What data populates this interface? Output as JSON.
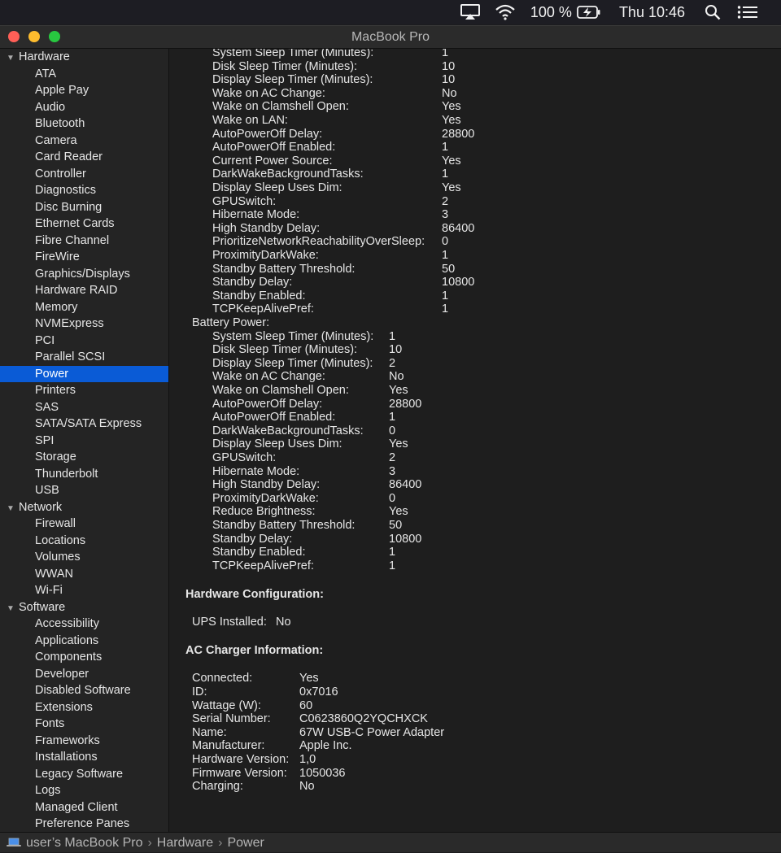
{
  "menubar": {
    "battery_percent": "100 %",
    "clock": "Thu 10:46"
  },
  "window": {
    "title": "MacBook Pro"
  },
  "sidebar": {
    "groups": [
      {
        "label": "Hardware",
        "items": [
          "ATA",
          "Apple Pay",
          "Audio",
          "Bluetooth",
          "Camera",
          "Card Reader",
          "Controller",
          "Diagnostics",
          "Disc Burning",
          "Ethernet Cards",
          "Fibre Channel",
          "FireWire",
          "Graphics/Displays",
          "Hardware RAID",
          "Memory",
          "NVMExpress",
          "PCI",
          "Parallel SCSI",
          "Power",
          "Printers",
          "SAS",
          "SATA/SATA Express",
          "SPI",
          "Storage",
          "Thunderbolt",
          "USB"
        ]
      },
      {
        "label": "Network",
        "items": [
          "Firewall",
          "Locations",
          "Volumes",
          "WWAN",
          "Wi-Fi"
        ]
      },
      {
        "label": "Software",
        "items": [
          "Accessibility",
          "Applications",
          "Components",
          "Developer",
          "Disabled Software",
          "Extensions",
          "Fonts",
          "Frameworks",
          "Installations",
          "Legacy Software",
          "Logs",
          "Managed Client",
          "Preference Panes"
        ]
      }
    ],
    "selected": "Power"
  },
  "content": {
    "ac_power_settings": [
      [
        "System Sleep Timer (Minutes):",
        "1"
      ],
      [
        "Disk Sleep Timer (Minutes):",
        "10"
      ],
      [
        "Display Sleep Timer (Minutes):",
        "10"
      ],
      [
        "Wake on AC Change:",
        "No"
      ],
      [
        "Wake on Clamshell Open:",
        "Yes"
      ],
      [
        "Wake on LAN:",
        "Yes"
      ],
      [
        "AutoPowerOff Delay:",
        "28800"
      ],
      [
        "AutoPowerOff Enabled:",
        "1"
      ],
      [
        "Current Power Source:",
        "Yes"
      ],
      [
        "DarkWakeBackgroundTasks:",
        "1"
      ],
      [
        "Display Sleep Uses Dim:",
        "Yes"
      ],
      [
        "GPUSwitch:",
        "2"
      ],
      [
        "Hibernate Mode:",
        "3"
      ],
      [
        "High Standby Delay:",
        "86400"
      ],
      [
        "PrioritizeNetworkReachabilityOverSleep:",
        "0"
      ],
      [
        "ProximityDarkWake:",
        "1"
      ],
      [
        "Standby Battery Threshold:",
        "50"
      ],
      [
        "Standby Delay:",
        "10800"
      ],
      [
        "Standby Enabled:",
        "1"
      ],
      [
        "TCPKeepAlivePref:",
        "1"
      ]
    ],
    "battery_power_label": "Battery Power:",
    "battery_power_settings": [
      [
        "System Sleep Timer (Minutes):",
        "1"
      ],
      [
        "Disk Sleep Timer (Minutes):",
        "10"
      ],
      [
        "Display Sleep Timer (Minutes):",
        "2"
      ],
      [
        "Wake on AC Change:",
        "No"
      ],
      [
        "Wake on Clamshell Open:",
        "Yes"
      ],
      [
        "AutoPowerOff Delay:",
        "28800"
      ],
      [
        "AutoPowerOff Enabled:",
        "1"
      ],
      [
        "DarkWakeBackgroundTasks:",
        "0"
      ],
      [
        "Display Sleep Uses Dim:",
        "Yes"
      ],
      [
        "GPUSwitch:",
        "2"
      ],
      [
        "Hibernate Mode:",
        "3"
      ],
      [
        "High Standby Delay:",
        "86400"
      ],
      [
        "ProximityDarkWake:",
        "0"
      ],
      [
        "Reduce Brightness:",
        "Yes"
      ],
      [
        "Standby Battery Threshold:",
        "50"
      ],
      [
        "Standby Delay:",
        "10800"
      ],
      [
        "Standby Enabled:",
        "1"
      ],
      [
        "TCPKeepAlivePref:",
        "1"
      ]
    ],
    "hardware_config_heading": "Hardware Configuration:",
    "ups_label": "UPS Installed:",
    "ups_value": "No",
    "ac_charger_heading": "AC Charger Information:",
    "ac_charger": [
      [
        "Connected:",
        "Yes"
      ],
      [
        "ID:",
        "0x7016"
      ],
      [
        "Wattage (W):",
        "60"
      ],
      [
        "Serial Number:",
        "C0623860Q2YQCHXCK"
      ],
      [
        "Name:",
        "67W USB-C Power Adapter"
      ],
      [
        "Manufacturer:",
        "Apple Inc."
      ],
      [
        "Hardware Version:",
        "1,0"
      ],
      [
        "Firmware Version:",
        "1050036"
      ],
      [
        "Charging:",
        "No"
      ]
    ]
  },
  "statusbar": {
    "path": [
      "user’s MacBook Pro",
      "Hardware",
      "Power"
    ]
  },
  "colors": {
    "selection": "#0a5bd6",
    "close": "#ff5f57",
    "minimize": "#febc2e",
    "zoom": "#28c840"
  }
}
